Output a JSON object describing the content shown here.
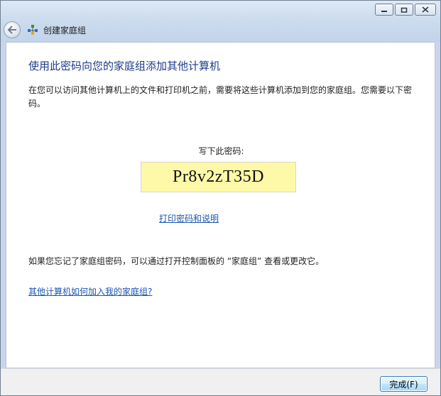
{
  "window": {
    "nav_title": "创建家庭组",
    "caption": {
      "minimize": "▭",
      "maximize": "▢",
      "close": "✕"
    }
  },
  "main": {
    "heading": "使用此密码向您的家庭组添加其他计算机",
    "description": "在您可以访问其他计算机上的文件和打印机之前，需要将这些计算机添加到您的家庭组。您需要以下密码。",
    "password_label": "写下此密码:",
    "password": "Pr8v2zT35D",
    "print_link": "打印密码和说明",
    "forgot_text": "如果您忘记了家庭组密码，可以通过打开控制面板的 “家庭组” 查看或更改它。",
    "join_link": "其他计算机如何加入我的家庭组?"
  },
  "footer": {
    "finish_label": "完成(F)"
  },
  "icons": {
    "back": "back-arrow-icon",
    "homegroup": "homegroup-icon"
  },
  "colors": {
    "heading": "#1e3b8b",
    "link": "#1a56b4",
    "password_bg": "#fdf9a8"
  }
}
